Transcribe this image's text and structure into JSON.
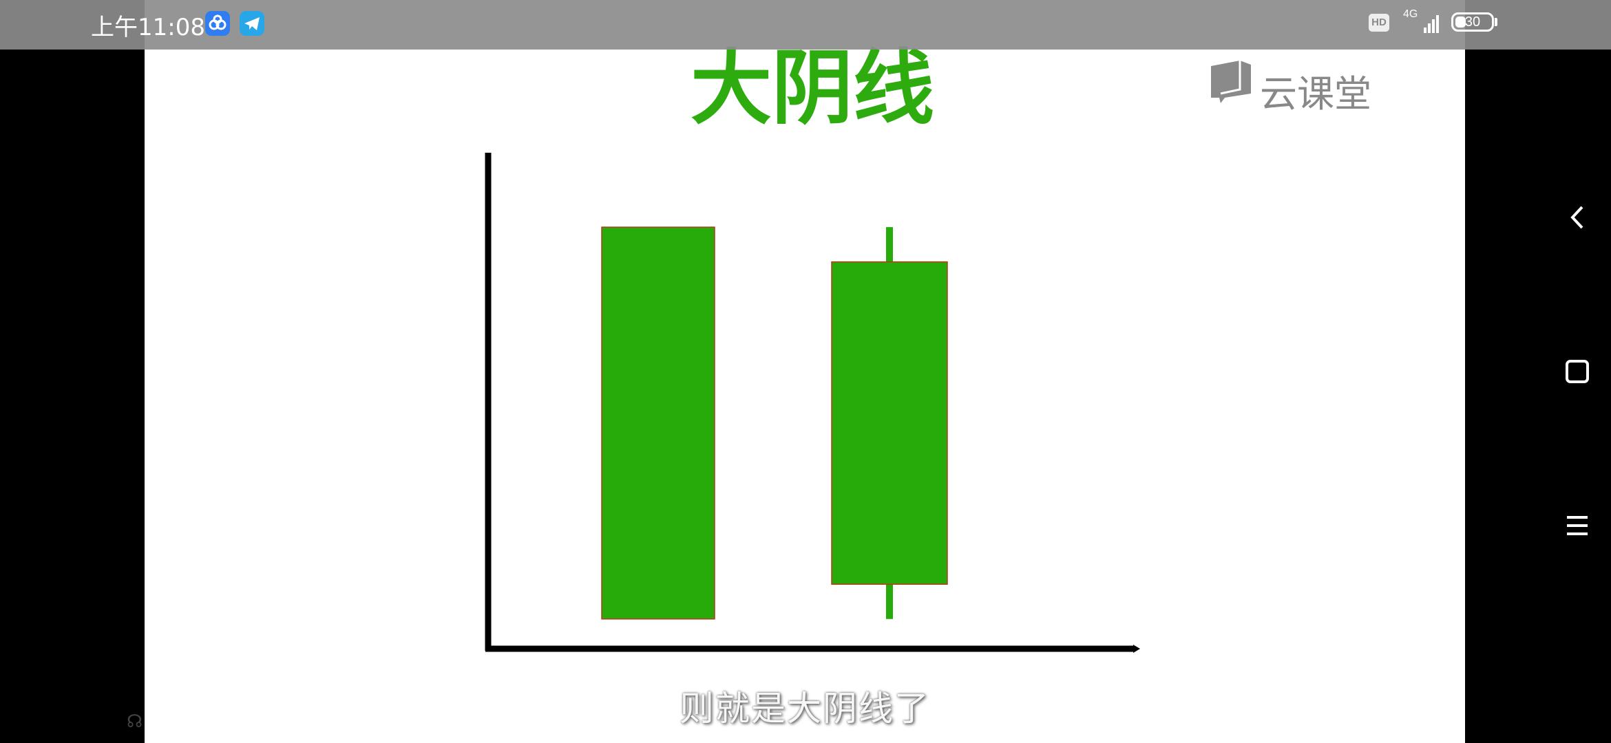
{
  "status_bar": {
    "time": "上午11:08",
    "hd_badge": "HD",
    "network": "4G",
    "battery_level": "30",
    "battery_percent": 30,
    "app_icons": [
      "baidu-netdisk-icon",
      "telegram-icon"
    ]
  },
  "video": {
    "title": "大阴线",
    "logo_text": "云课堂",
    "subtitle": "则就是大阴线了",
    "title_color": "#2eac0f",
    "candle_color": "#27ab0a"
  },
  "navigation": {
    "icons": [
      "back-chevron-icon",
      "home-square-icon",
      "menu-lines-icon"
    ]
  },
  "chart_data": {
    "type": "candlestick",
    "title": "大阴线",
    "xlabel": "",
    "ylabel": "",
    "candles": [
      {
        "open": 8.5,
        "high": 8.5,
        "low": 0.6,
        "close": 0.6
      },
      {
        "open": 7.8,
        "high": 8.5,
        "low": 0.6,
        "close": 1.3
      }
    ],
    "ylim": [
      0,
      10
    ],
    "grid": false,
    "legend": "none"
  }
}
